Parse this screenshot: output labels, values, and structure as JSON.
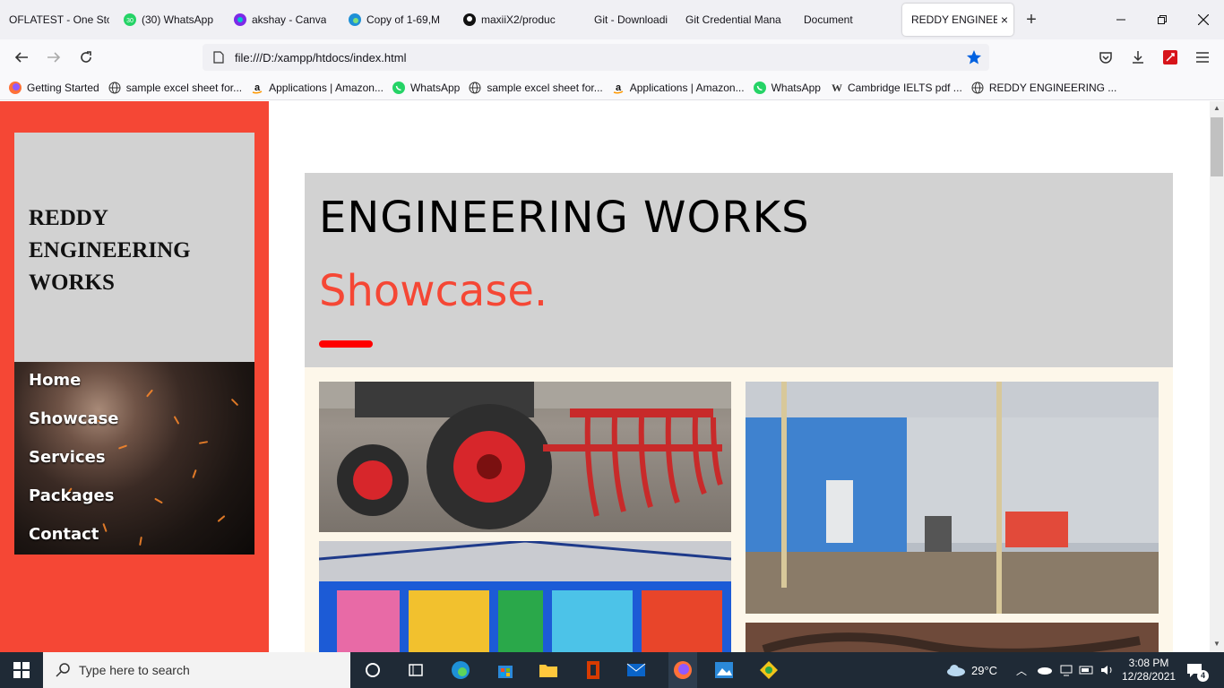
{
  "browser": {
    "tabs": [
      {
        "label": "OFLATEST - One Sto",
        "icon": "page-icon"
      },
      {
        "label": "(30) WhatsApp",
        "icon": "whatsapp-icon",
        "badge": "30"
      },
      {
        "label": "akshay - Canva",
        "icon": "canva-icon"
      },
      {
        "label": "Copy of 1-69,M",
        "icon": "edge-icon"
      },
      {
        "label": "maxiiX2/produc",
        "icon": "github-icon"
      },
      {
        "label": "Git - Downloadi",
        "icon": "page-icon"
      },
      {
        "label": "Git Credential Mana",
        "icon": "page-icon"
      },
      {
        "label": "Document",
        "icon": "page-icon"
      },
      {
        "label": "REDDY ENGINEER",
        "icon": "page-icon",
        "active": true
      }
    ],
    "new_tab_label": "+",
    "url": "file:///D:/xampp/htdocs/index.html",
    "bookmarks": [
      {
        "label": "Getting Started",
        "icon": "firefox-icon"
      },
      {
        "label": "sample excel sheet for...",
        "icon": "globe-icon"
      },
      {
        "label": "Applications | Amazon...",
        "icon": "amazon-icon"
      },
      {
        "label": "WhatsApp",
        "icon": "whatsapp-icon"
      },
      {
        "label": "sample excel sheet for...",
        "icon": "globe-icon"
      },
      {
        "label": "Applications | Amazon...",
        "icon": "amazon-icon"
      },
      {
        "label": "WhatsApp",
        "icon": "whatsapp-icon"
      },
      {
        "label": "Cambridge IELTS pdf ...",
        "icon": "w-icon"
      },
      {
        "label": "REDDY ENGINEERING ...",
        "icon": "globe-icon"
      }
    ]
  },
  "site": {
    "brand_lines": [
      "REDDY",
      "ENGINEERING",
      "WORKS"
    ],
    "nav": [
      "Home",
      "Showcase",
      "Services",
      "Packages",
      "Contact"
    ],
    "hero_title": "ENGINEERING WORKS",
    "hero_subtitle": "Showcase.",
    "colors": {
      "sidebar": "#f54735",
      "accent": "#f54735",
      "panel": "#d2d2d2",
      "bar": "#ff0000"
    }
  },
  "taskbar": {
    "search_placeholder": "Type here to search",
    "weather": "29°C",
    "time": "3:08 PM",
    "date": "12/28/2021",
    "notification_count": "4"
  }
}
